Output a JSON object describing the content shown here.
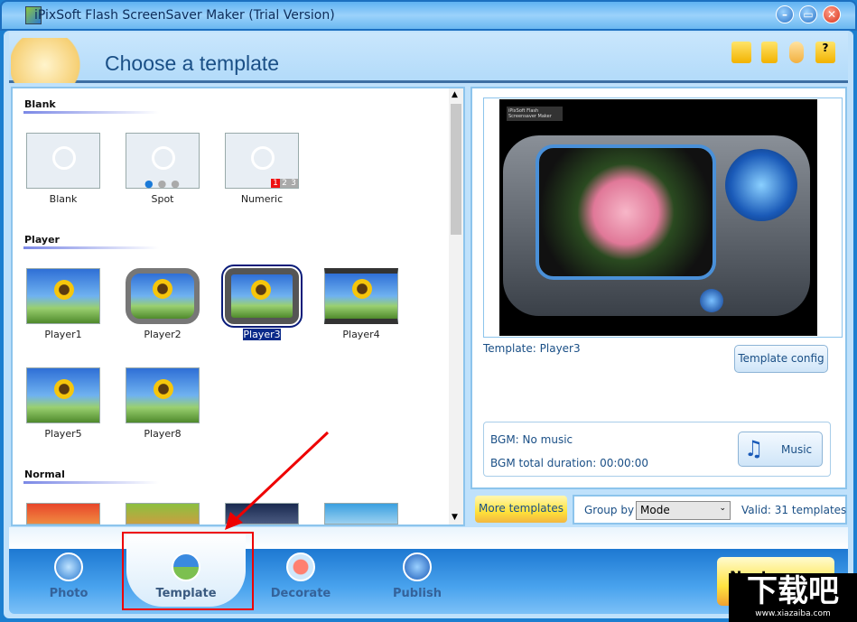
{
  "window": {
    "title": "iPixSoft Flash ScreenSaver Maker (Trial Version)",
    "controls": [
      "minimize",
      "restore",
      "close"
    ]
  },
  "header": {
    "title": "Choose a template",
    "icons": [
      "open-folder-icon",
      "save-icon",
      "user-icon",
      "help-icon"
    ]
  },
  "sections": [
    {
      "label": "Blank",
      "items": [
        {
          "label": "Blank",
          "kind": "blank"
        },
        {
          "label": "Spot",
          "kind": "spot"
        },
        {
          "label": "Numeric",
          "kind": "numeric",
          "digits": [
            "1",
            "2",
            "3"
          ]
        }
      ]
    },
    {
      "label": "Player",
      "items": [
        {
          "label": "Player1"
        },
        {
          "label": "Player2"
        },
        {
          "label": "Player3",
          "selected": true
        },
        {
          "label": "Player4"
        },
        {
          "label": "Player5"
        },
        {
          "label": "Player8"
        }
      ]
    },
    {
      "label": "Normal",
      "items": [
        {
          "label": ""
        },
        {
          "label": ""
        },
        {
          "label": ""
        },
        {
          "label": ""
        }
      ]
    }
  ],
  "preview": {
    "caption_image": "iPixSoft Flash Screensaver Maker",
    "template_label": "Template:",
    "template_name": "Player3",
    "config_button": "Template config"
  },
  "bgm": {
    "music": "BGM: No music",
    "duration": "BGM total duration: 00:00:00",
    "music_button": "Music"
  },
  "footer": {
    "more_templates": "More templates",
    "group_by_label": "Group by",
    "group_by_value": "Mode",
    "valid": "Valid: 31 templates"
  },
  "nav": [
    {
      "label": "Photo"
    },
    {
      "label": "Template",
      "active": true
    },
    {
      "label": "Decorate"
    },
    {
      "label": "Publish"
    }
  ],
  "next_button": "Next",
  "watermark": {
    "text": "下载吧",
    "url": "www.xiazaiba.com"
  }
}
